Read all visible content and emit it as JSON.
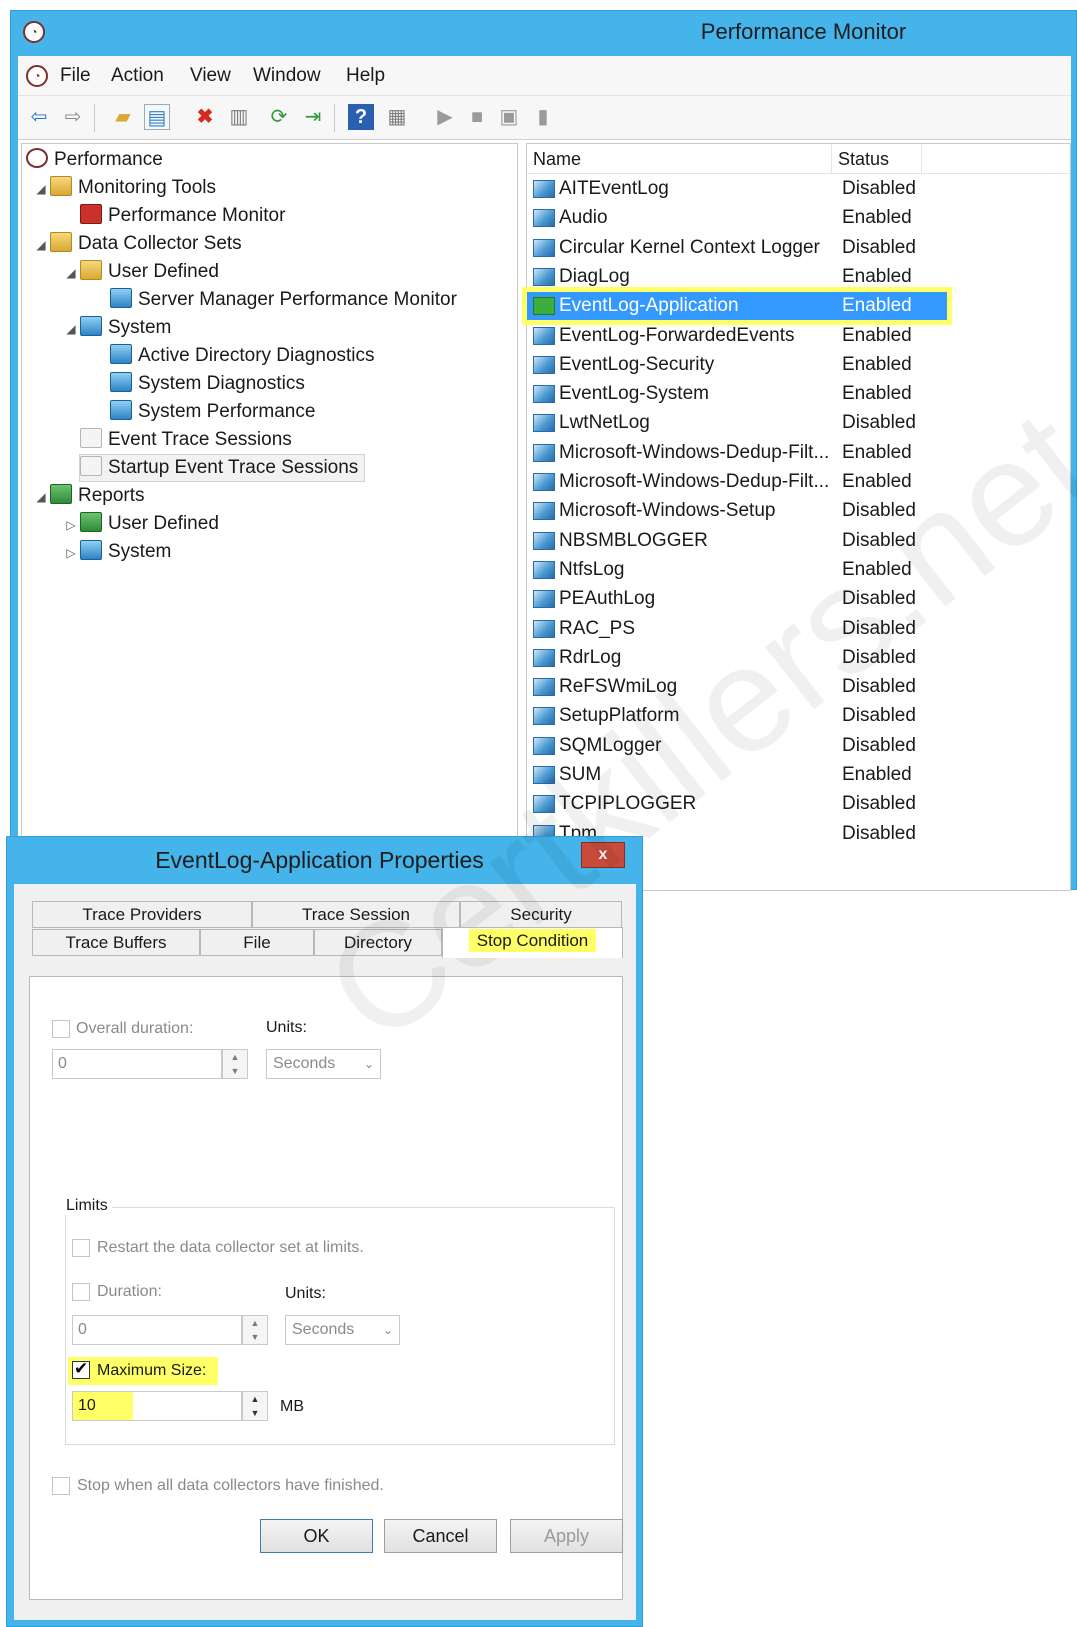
{
  "main_window": {
    "title": "Performance Monitor",
    "menu": [
      "File",
      "Action",
      "View",
      "Window",
      "Help"
    ]
  },
  "tree": [
    {
      "label": "Performance",
      "icon": "perfmon-logo-icon",
      "arrow": ""
    },
    {
      "label": "Monitoring Tools",
      "icon": "folder-icon",
      "arrow": "◢"
    },
    {
      "label": "Performance Monitor",
      "icon": "performance-monitor-icon",
      "arrow": ""
    },
    {
      "label": "Data Collector Sets",
      "icon": "folder-icon",
      "arrow": "◢"
    },
    {
      "label": "User Defined",
      "icon": "user-folder-icon",
      "arrow": "◢"
    },
    {
      "label": "Server Manager Performance Monitor",
      "icon": "data-collector-set-icon",
      "arrow": ""
    },
    {
      "label": "System",
      "icon": "system-folder-icon",
      "arrow": "◢"
    },
    {
      "label": "Active Directory Diagnostics",
      "icon": "data-collector-set-icon",
      "arrow": ""
    },
    {
      "label": "System Diagnostics",
      "icon": "data-collector-set-icon",
      "arrow": ""
    },
    {
      "label": "System Performance",
      "icon": "data-collector-set-icon",
      "arrow": ""
    },
    {
      "label": "Event Trace Sessions",
      "icon": "trace-sessions-icon",
      "arrow": ""
    },
    {
      "label": "Startup Event Trace Sessions",
      "icon": "trace-sessions-icon",
      "arrow": ""
    },
    {
      "label": "Reports",
      "icon": "reports-folder-icon",
      "arrow": "◢"
    },
    {
      "label": "User Defined",
      "icon": "report-icon",
      "arrow": "▷"
    },
    {
      "label": "System",
      "icon": "report-icon",
      "arrow": "▷"
    }
  ],
  "list": {
    "columns": {
      "name": "Name",
      "status": "Status"
    },
    "rows": [
      {
        "name": "AITEventLog",
        "status": "Disabled"
      },
      {
        "name": "Audio",
        "status": "Enabled"
      },
      {
        "name": "Circular Kernel Context Logger",
        "status": "Disabled"
      },
      {
        "name": "DiagLog",
        "status": "Enabled"
      },
      {
        "name": "EventLog-Application",
        "status": "Enabled",
        "selected": true
      },
      {
        "name": "EventLog-ForwardedEvents",
        "status": "Enabled"
      },
      {
        "name": "EventLog-Security",
        "status": "Enabled"
      },
      {
        "name": "EventLog-System",
        "status": "Enabled"
      },
      {
        "name": "LwtNetLog",
        "status": "Disabled"
      },
      {
        "name": "Microsoft-Windows-Dedup-Filt...",
        "status": "Enabled"
      },
      {
        "name": "Microsoft-Windows-Dedup-Filt...",
        "status": "Enabled"
      },
      {
        "name": "Microsoft-Windows-Setup",
        "status": "Disabled"
      },
      {
        "name": "NBSMBLOGGER",
        "status": "Disabled"
      },
      {
        "name": "NtfsLog",
        "status": "Enabled"
      },
      {
        "name": "PEAuthLog",
        "status": "Disabled"
      },
      {
        "name": "RAC_PS",
        "status": "Disabled"
      },
      {
        "name": "RdrLog",
        "status": "Disabled"
      },
      {
        "name": "ReFSWmiLog",
        "status": "Disabled"
      },
      {
        "name": "SetupPlatform",
        "status": "Disabled"
      },
      {
        "name": "SQMLogger",
        "status": "Disabled"
      },
      {
        "name": "SUM",
        "status": "Enabled"
      },
      {
        "name": "TCPIPLOGGER",
        "status": "Disabled"
      },
      {
        "name": "Tpm",
        "status": "Disabled"
      }
    ]
  },
  "dialog": {
    "title": "EventLog-Application Properties",
    "close": "x",
    "tabs_row1": [
      "Trace Providers",
      "Trace Session",
      "Security"
    ],
    "tabs_row2": [
      "Trace Buffers",
      "File",
      "Directory",
      "Stop Condition"
    ],
    "active_tab": "Stop Condition",
    "overall_duration": {
      "label": "Overall duration:",
      "checked": false,
      "value": "0",
      "units_label": "Units:",
      "units": "Seconds"
    },
    "limits": {
      "group_label": "Limits",
      "restart_label": "Restart the data collector set at limits.",
      "duration_label": "Duration:",
      "duration_value": "0",
      "units_label": "Units:",
      "units": "Seconds",
      "max_size_label": "Maximum Size:",
      "max_size_checked": true,
      "max_size_value": "10",
      "max_size_unit": "MB"
    },
    "stop_when_label": "Stop when all data collectors have finished.",
    "buttons": {
      "ok": "OK",
      "cancel": "Cancel",
      "apply": "Apply"
    }
  },
  "watermark": "Certkillers.net",
  "colors": {
    "titlebar": "#45b4ea",
    "selection": "#3399ff",
    "highlight": "#ffff66"
  }
}
